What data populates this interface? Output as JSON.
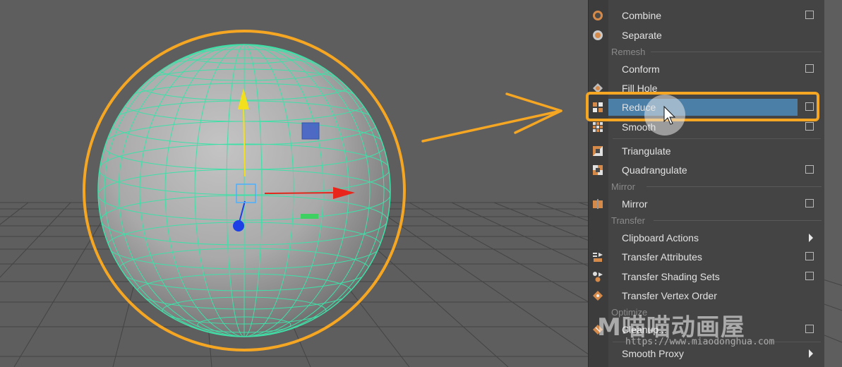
{
  "menu": {
    "items": {
      "combine": {
        "label": "Combine"
      },
      "separate": {
        "label": "Separate"
      },
      "conform": {
        "label": "Conform"
      },
      "fill_hole": {
        "label": "Fill Hole"
      },
      "reduce": {
        "label": "Reduce"
      },
      "smooth": {
        "label": "Smooth"
      },
      "triangulate": {
        "label": "Triangulate"
      },
      "quadrangulate": {
        "label": "Quadrangulate"
      },
      "mirror": {
        "label": "Mirror"
      },
      "clipboard_actions": {
        "label": "Clipboard Actions"
      },
      "transfer_attributes": {
        "label": "Transfer Attributes"
      },
      "transfer_shading_sets": {
        "label": "Transfer Shading Sets"
      },
      "transfer_vertex_order": {
        "label": "Transfer Vertex Order"
      },
      "cleanup": {
        "label": "Cleanup..."
      },
      "smooth_proxy": {
        "label": "Smooth Proxy"
      }
    },
    "sections": {
      "remesh": "Remesh",
      "mirror": "Mirror",
      "transfer": "Transfer",
      "optimize": "Optimize"
    },
    "highlighted_item": "Reduce"
  },
  "annotation": {
    "highlight_color": "#f5a623",
    "selection_color": "#4b7fa8"
  },
  "viewport": {
    "wireframe_color": "#3fe0a8",
    "axis_colors": {
      "x": "#e8241b",
      "y": "#f3e01c",
      "z": "#1d3fe6"
    }
  },
  "watermark": {
    "logo_text": "M喵喵动画屋",
    "url": "https://www.miaodonghua.com"
  }
}
